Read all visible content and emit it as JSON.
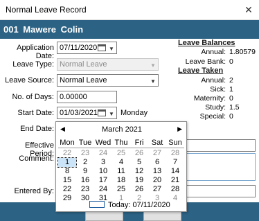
{
  "window": {
    "title": "Normal Leave Record",
    "close": "✕"
  },
  "employee": {
    "header": "001  Mawere  Colin"
  },
  "form": {
    "application_date_label": "Application Date:",
    "application_date": "07/11/2020",
    "leave_type_label": "Leave Type:",
    "leave_type": "Normal Leave",
    "leave_source_label": "Leave Source:",
    "leave_source": "Normal Leave",
    "days_label": "No. of Days:",
    "days": "0.00000",
    "start_date_label": "Start Date:",
    "start_date": "01/03/2021",
    "start_day": "Monday",
    "end_date_label": "End Date:",
    "effective_period_label": "Effective Period:",
    "comment_label": "Comment:",
    "entered_by_label": "Entered By:"
  },
  "balances": {
    "title": "Leave Balances",
    "annual_label": "Annual:",
    "annual": "1.80579",
    "bank_label": "Leave Bank:",
    "bank": "0"
  },
  "taken": {
    "title": "Leave Taken",
    "annual_label": "Annual:",
    "annual": "2",
    "sick_label": "Sick:",
    "sick": "1",
    "maternity_label": "Maternity:",
    "maternity": "0",
    "study_label": "Study:",
    "study": "1.5",
    "special_label": "Special:",
    "special": "0"
  },
  "calendar": {
    "month": "March 2021",
    "prev": "◀",
    "next": "▶",
    "days": [
      "Mon",
      "Tue",
      "Wed",
      "Thu",
      "Fri",
      "Sat",
      "Sun"
    ],
    "weeks": [
      [
        "22",
        "23",
        "24",
        "25",
        "26",
        "27",
        "28"
      ],
      [
        "1",
        "2",
        "3",
        "4",
        "5",
        "6",
        "7"
      ],
      [
        "8",
        "9",
        "10",
        "11",
        "12",
        "13",
        "14"
      ],
      [
        "15",
        "16",
        "17",
        "18",
        "19",
        "20",
        "21"
      ],
      [
        "22",
        "23",
        "24",
        "25",
        "26",
        "27",
        "28"
      ],
      [
        "29",
        "30",
        "31",
        "1",
        "2",
        "3",
        "4"
      ]
    ],
    "today": "Today: 07/11/2020"
  },
  "colors": {
    "header_band": "#2c6283",
    "accent": "#1f5fa0"
  }
}
